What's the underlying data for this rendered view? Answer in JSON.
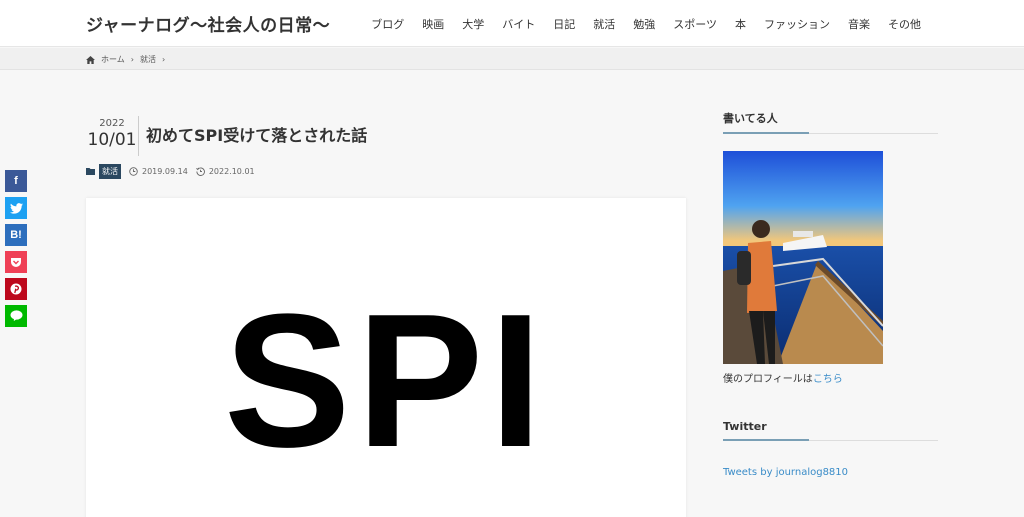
{
  "site": {
    "title": "ジャーナログ〜社会人の日常〜"
  },
  "nav": {
    "items": [
      {
        "label": "ブログ"
      },
      {
        "label": "映画"
      },
      {
        "label": "大学"
      },
      {
        "label": "バイト"
      },
      {
        "label": "日記"
      },
      {
        "label": "就活"
      },
      {
        "label": "勉強"
      },
      {
        "label": "スポーツ"
      },
      {
        "label": "本"
      },
      {
        "label": "ファッション"
      },
      {
        "label": "音楽"
      },
      {
        "label": "その他"
      }
    ]
  },
  "breadcrumb": {
    "home": "ホーム",
    "category": "就活",
    "separator": "›"
  },
  "share": {
    "buttons": [
      {
        "label": "f",
        "icon": "facebook-icon",
        "color": "#3b5998"
      },
      {
        "label": "t",
        "icon": "twitter-icon",
        "color": "#1da1f2"
      },
      {
        "label": "B!",
        "icon": "hatena-icon",
        "color": "#2c6ebd"
      },
      {
        "label": "P",
        "icon": "pocket-icon",
        "color": "#ef4056"
      },
      {
        "label": "p",
        "icon": "pinterest-icon",
        "color": "#bd081c"
      },
      {
        "label": "L",
        "icon": "line-icon",
        "color": "#00b900"
      }
    ]
  },
  "post": {
    "year": "2022",
    "month_day": "10/01",
    "title": "初めてSPI受けて落とされた話",
    "category": "就活",
    "published": "2019.09.14",
    "updated": "2022.10.01",
    "eyecatch_text": "SPI"
  },
  "sidebar": {
    "author_title": "書いてる人",
    "profile_text": "僕のプロフィールは",
    "profile_link": "こちら",
    "twitter_title": "Twitter",
    "tweets_link": "Tweets by journalog8810"
  },
  "colors": {
    "accent": "#2b4860",
    "link": "#3a8cc8",
    "underline": "#7a9fb5"
  }
}
